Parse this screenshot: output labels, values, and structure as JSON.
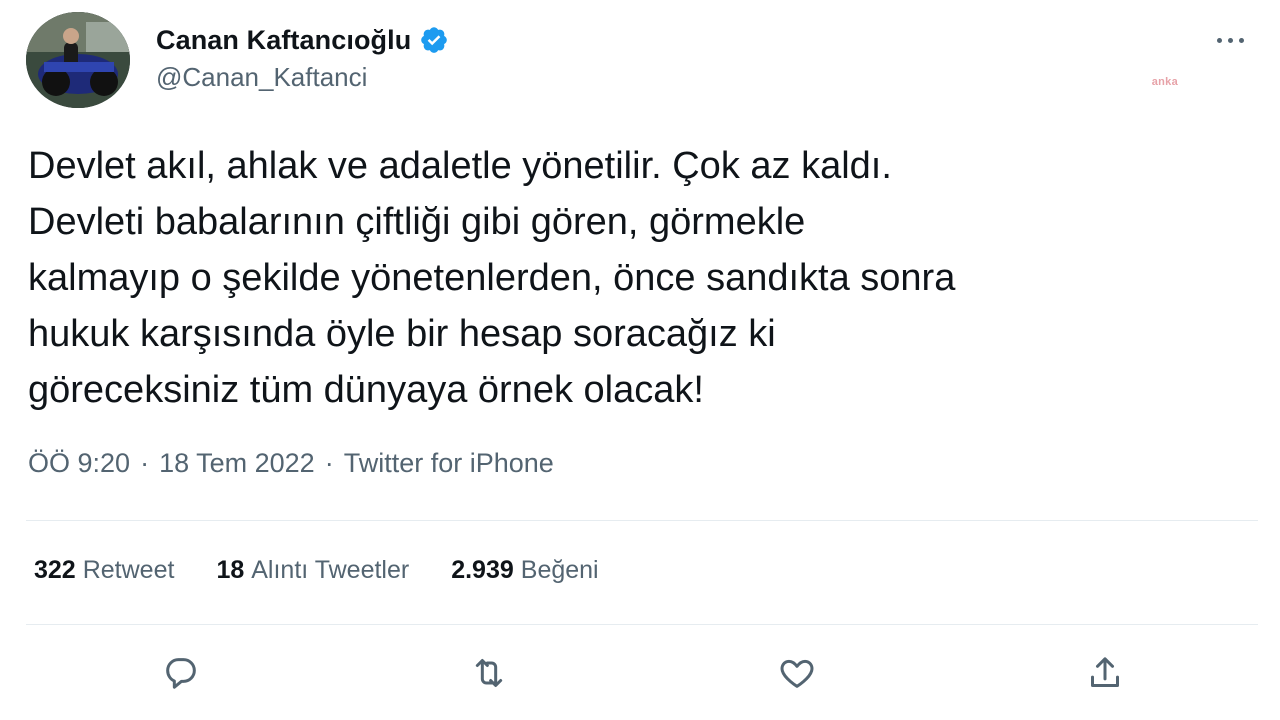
{
  "author": {
    "display_name": "Canan Kaftancıoğlu",
    "handle": "@Canan_Kaftanci",
    "verified": true
  },
  "watermark_text": "anka",
  "tweet": {
    "lines": [
      "Devlet akıl, ahlak ve adaletle yönetilir. Çok az kaldı.",
      "Devleti babalarının çiftliği gibi gören, görmekle",
      "kalmayıp o şekilde yönetenlerden, önce sandıkta sonra",
      "hukuk karşısında öyle bir hesap soracağız ki",
      "göreceksiniz tüm dünyaya örnek olacak!"
    ],
    "time": "ÖÖ 9:20",
    "date": "18 Tem 2022",
    "source": "Twitter for iPhone",
    "separator": "·"
  },
  "stats": {
    "retweets": {
      "count": "322",
      "label": "Retweet"
    },
    "quotes": {
      "count": "18",
      "label": "Alıntı Tweetler"
    },
    "likes": {
      "count": "2.939",
      "label": "Beğeni"
    }
  },
  "actions": {
    "reply_icon": "reply-icon",
    "retweet_icon": "retweet-icon",
    "like_icon": "heart-icon",
    "share_icon": "share-icon"
  },
  "colors": {
    "text_primary": "#0f1419",
    "text_secondary": "#536471",
    "verified_blue": "#1d9bf0",
    "divider": "#e6ecf0"
  }
}
